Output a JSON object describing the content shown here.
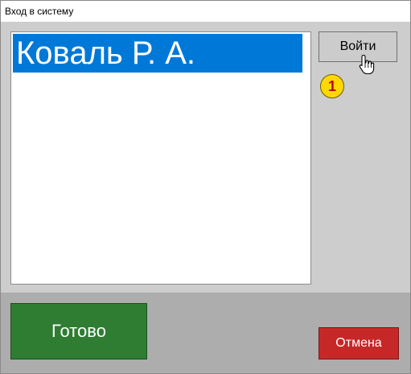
{
  "window": {
    "title": "Вход в систему"
  },
  "users_list": {
    "items": [
      {
        "label": "Коваль Р. А.",
        "selected": true
      }
    ],
    "selection_color": "#0078d7"
  },
  "actions": {
    "login_label": "Войти",
    "ok_label": "Готово",
    "cancel_label": "Отмена"
  },
  "annotation": {
    "step_number": "1"
  },
  "colors": {
    "ok_button": "#2e7d32",
    "cancel_button": "#c62828",
    "step_badge": "#ffd800"
  },
  "icons": {
    "cursor": "hand-pointer-icon"
  }
}
